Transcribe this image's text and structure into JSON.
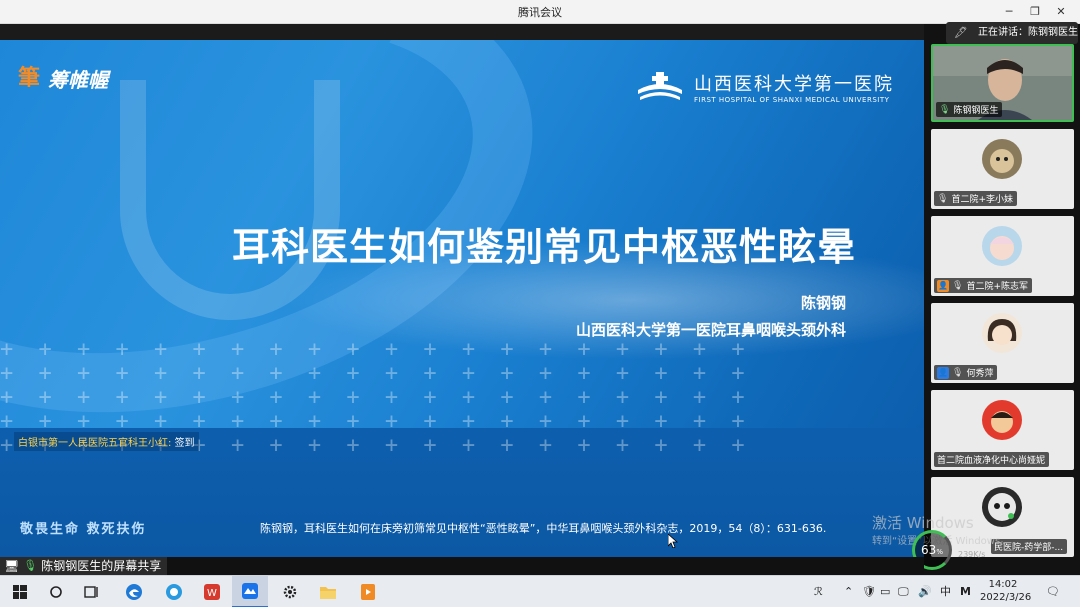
{
  "window": {
    "title": "腾讯会议"
  },
  "slide": {
    "logo_left": "筹帷幄",
    "logo_right_cn": "山西医科大学第一医院",
    "logo_right_en": "FIRST HOSPITAL OF SHANXI MEDICAL UNIVERSITY",
    "title": "耳科医生如何鉴别常见中枢恶性眩晕",
    "author": "陈钢钢",
    "affiliation": "山西医科大学第一医院耳鼻咽喉头颈外科",
    "checkin_name": "白银市第一人民医院五官科王小红:",
    "checkin_status": "签到",
    "motto": "敬畏生命  救死扶伤",
    "citation": "陈钢钢，耳科医生如何在床旁初筛常见中枢性“恶性眩晕”，中华耳鼻咽喉头颈外科杂志，2019，54（8）：631-636."
  },
  "panel": {
    "speaking": "正在讲话：陈钢钢医生",
    "participants": [
      {
        "name": "陈钢钢医生"
      },
      {
        "name": "首二院+李小妹"
      },
      {
        "name": "首二院+陈志军"
      },
      {
        "name": "何秀萍"
      },
      {
        "name": "首二院血液净化中心尚娅妮"
      },
      {
        "name": "民医院-药学部-..."
      }
    ],
    "network_percent": "63",
    "network_unit": "%",
    "network_speed": "239K/s"
  },
  "watermark": {
    "line1": "激活 Windows",
    "line2": "转到“设置”以激活 Windows。"
  },
  "share": {
    "label": "陈钢钢医生的屏幕共享"
  },
  "taskbar": {
    "ime": "中",
    "ime_mode": "M",
    "time": "14:02",
    "date": "2022/3/26"
  }
}
